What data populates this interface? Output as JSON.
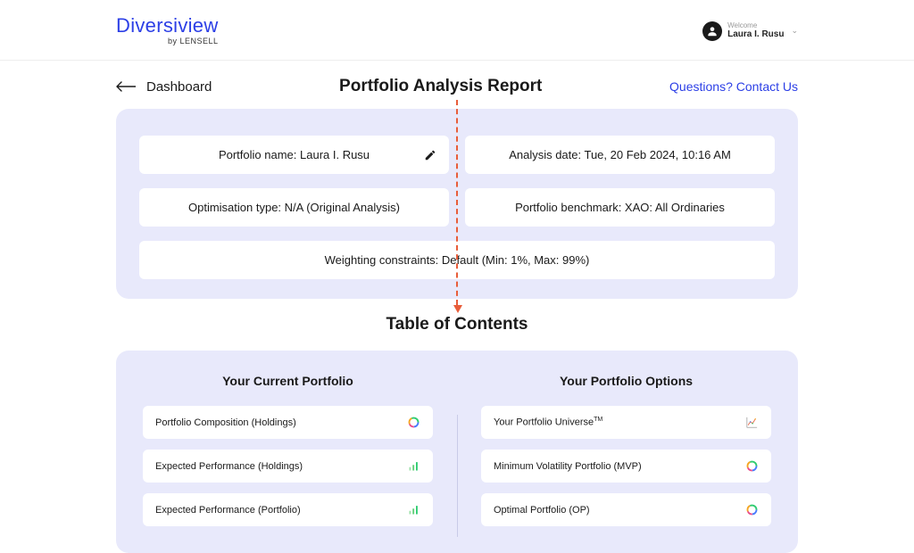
{
  "brand": {
    "title": "Diversiview",
    "sub": "by LENSELL"
  },
  "user": {
    "welcome": "Welcome",
    "name": "Laura I. Rusu"
  },
  "subheader": {
    "back": "Dashboard",
    "title": "Portfolio Analysis Report",
    "contact": "Questions? Contact Us"
  },
  "info": {
    "portfolio_name": "Portfolio name: Laura I. Rusu",
    "analysis_date": "Analysis date: Tue, 20 Feb 2024, 10:16 AM",
    "optimisation_type": "Optimisation type: N/A (Original Analysis)",
    "benchmark": "Portfolio benchmark: XAO: All Ordinaries",
    "constraints": "Weighting constraints: Default (Min: 1%, Max: 99%)"
  },
  "toc": {
    "title": "Table of Contents",
    "left_heading": "Your Current Portfolio",
    "right_heading": "Your Portfolio Options",
    "left": [
      "Portfolio Composition (Holdings)",
      "Expected Performance (Holdings)",
      "Expected Performance (Portfolio)"
    ],
    "right": [
      "Your Portfolio Universe",
      "Minimum Volatility Portfolio (MVP)",
      "Optimal Portfolio (OP)"
    ]
  }
}
